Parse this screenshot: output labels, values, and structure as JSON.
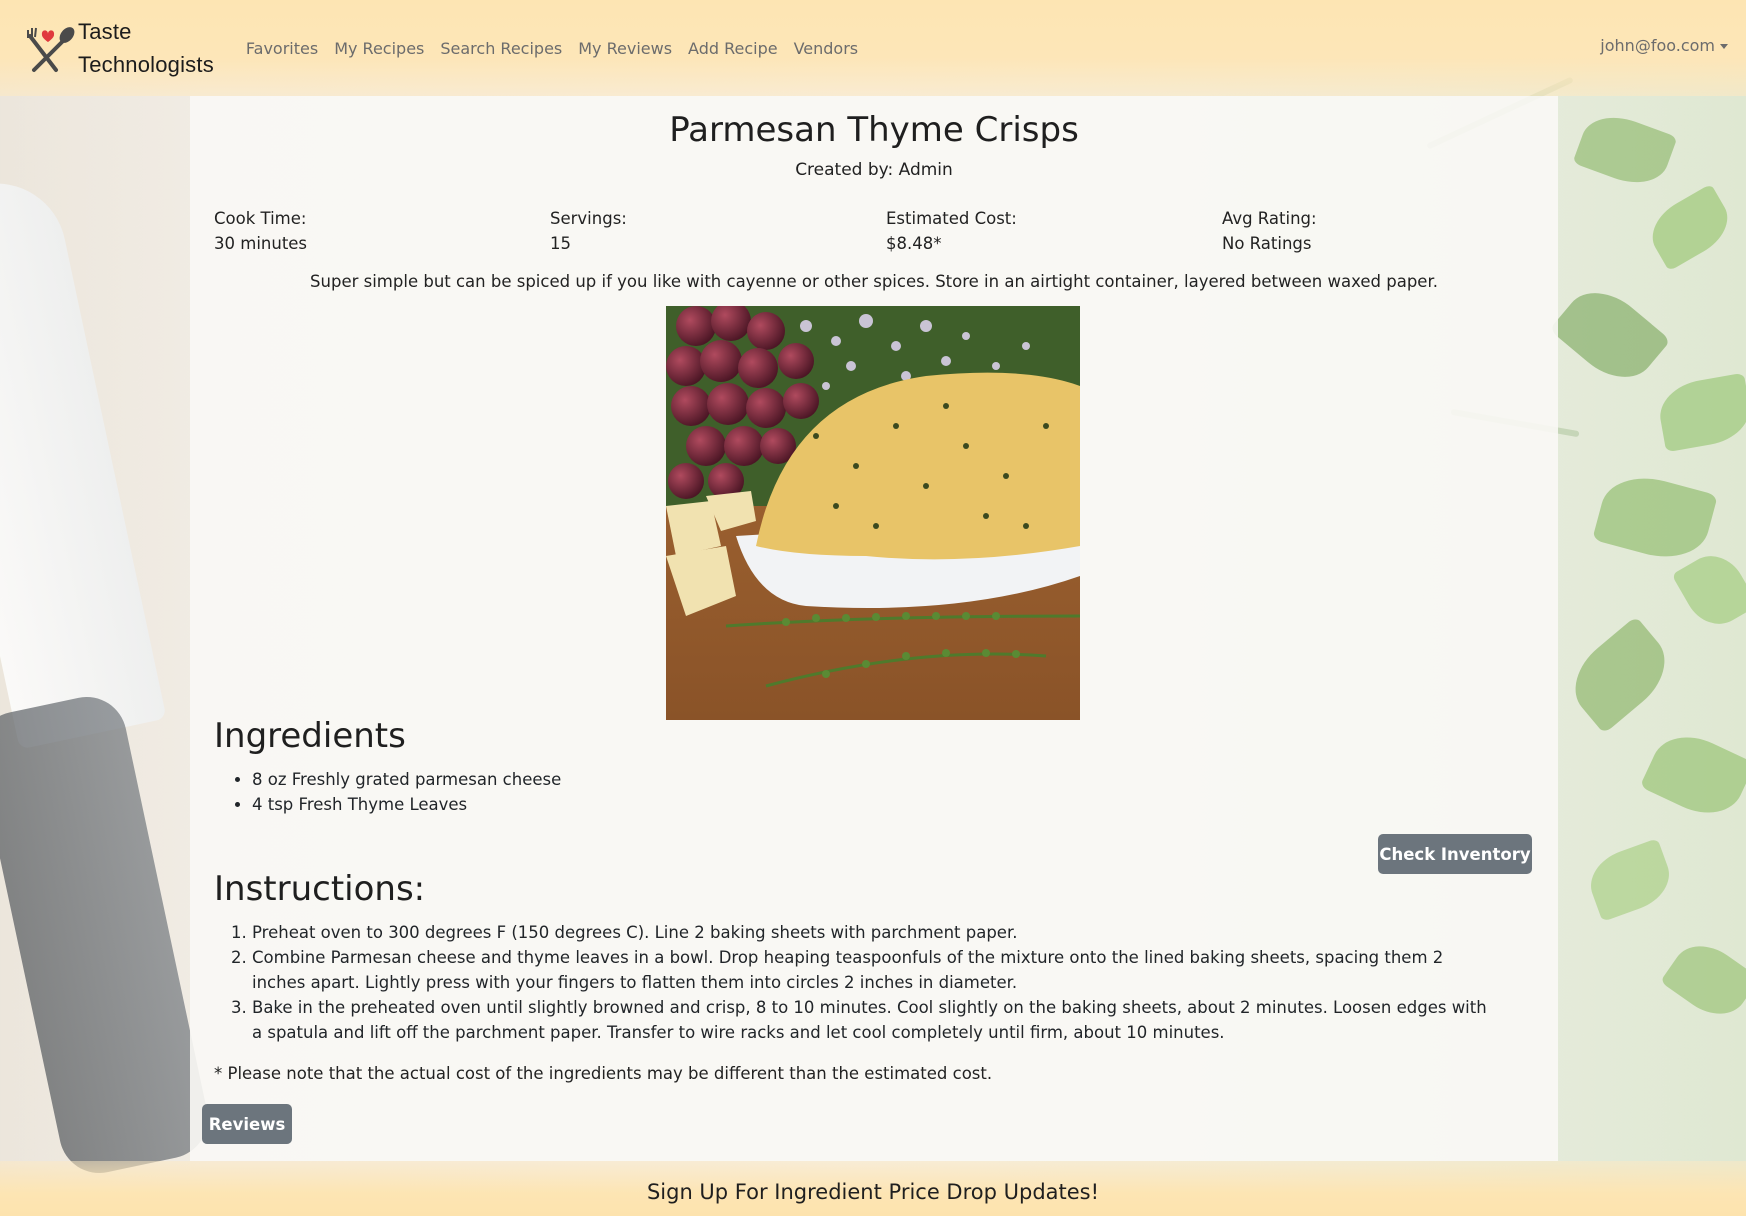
{
  "brand": {
    "line1": "Taste",
    "line2": "Technologists",
    "icon": "crossed-utensils-heart-icon"
  },
  "nav": {
    "links": [
      "Favorites",
      "My Recipes",
      "Search Recipes",
      "My Reviews",
      "Add Recipe",
      "Vendors"
    ],
    "user": "john@foo.com"
  },
  "recipe": {
    "title": "Parmesan Thyme Crisps",
    "created_by": "Created by: Admin",
    "stats": [
      {
        "label": "Cook Time:",
        "value": "30 minutes"
      },
      {
        "label": "Servings:",
        "value": "15"
      },
      {
        "label": "Estimated Cost:",
        "value": "$8.48*"
      },
      {
        "label": "Avg Rating:",
        "value": "No Ratings"
      }
    ],
    "description": "Super simple but can be spiced up if you like with cayenne or other spices. Store in an airtight container, layered between waxed paper.",
    "ingredients_heading": "Ingredients",
    "ingredients": [
      "8 oz Freshly grated parmesan cheese",
      "4 tsp Fresh Thyme Leaves"
    ],
    "check_inventory_label": "Check Inventory",
    "instructions_heading": "Instructions:",
    "instructions": [
      "Preheat oven to 300 degrees F (150 degrees C). Line 2 baking sheets with parchment paper.",
      "Combine Parmesan cheese and thyme leaves in a bowl. Drop heaping teaspoonfuls of the mixture onto the lined baking sheets, spacing them 2 inches apart. Lightly press with your fingers to flatten them into circles 2 inches in diameter.",
      "Bake in the preheated oven until slightly browned and crisp, 8 to 10 minutes. Cool slightly on the baking sheets, about 2 minutes. Loosen edges with a spatula and lift off the parchment paper. Transfer to wire racks and let cool completely until firm, about 10 minutes."
    ],
    "cost_note": "* Please note that the actual cost of the ingredients may be different than the estimated cost.",
    "reviews_label": "Reviews"
  },
  "footer": {
    "signup_label": "Sign Up For Ingredient Price Drop Updates!"
  },
  "colors": {
    "navbar": "#fde5b3",
    "button": "#6c757d",
    "heart": "#e0393e"
  }
}
